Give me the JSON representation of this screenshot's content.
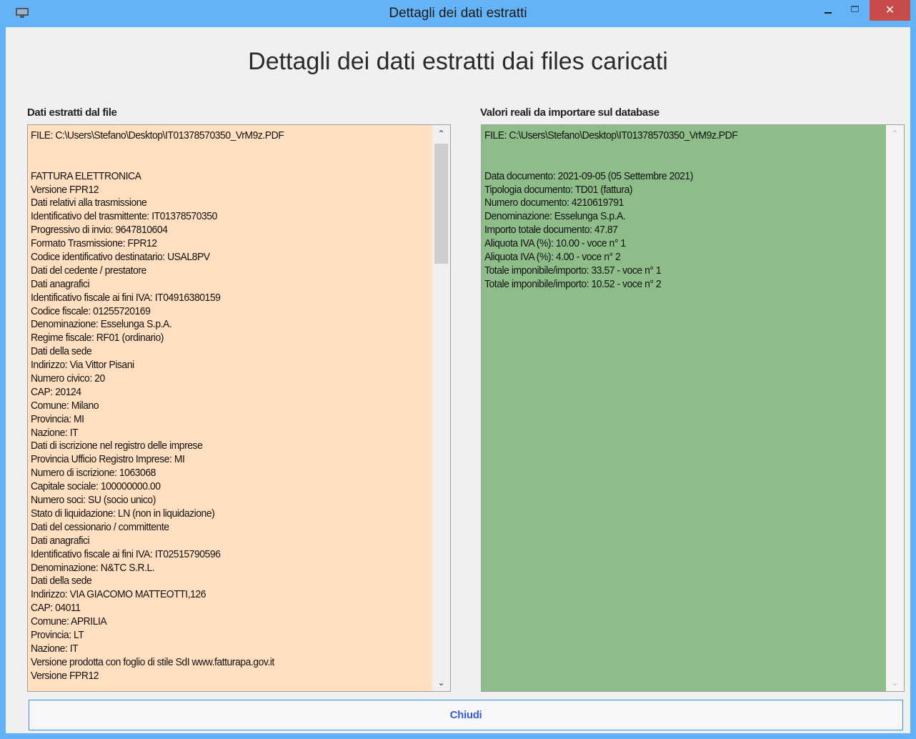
{
  "window": {
    "title": "Dettagli dei dati estratti"
  },
  "main": {
    "title": "Dettagli dei dati estratti dai files caricati",
    "left_label": "Dati estratti dal file",
    "right_label": "Valori reali da importare sul database",
    "left_lines": [
      "FILE: C:\\Users\\Stefano\\Desktop\\IT01378570350_VrM9z.PDF",
      "",
      "",
      "FATTURA ELETTRONICA",
      "Versione FPR12",
      "Dati relativi alla trasmissione",
      "Identificativo del trasmittente: IT01378570350",
      "Progressivo di invio: 9647810604",
      "Formato Trasmissione: FPR12",
      "Codice identificativo destinatario: USAL8PV",
      "Dati del cedente / prestatore",
      "Dati anagrafici",
      "Identificativo fiscale ai fini IVA: IT04916380159",
      "Codice fiscale: 01255720169",
      "Denominazione: Esselunga S.p.A.",
      "Regime fiscale: RF01 (ordinario)",
      "Dati della sede",
      "Indirizzo: Via Vittor Pisani",
      "Numero civico: 20",
      "CAP: 20124",
      "Comune: Milano",
      "Provincia: MI",
      "Nazione: IT",
      "Dati di iscrizione nel registro delle imprese",
      "Provincia Ufficio Registro Imprese: MI",
      "Numero di iscrizione: 1063068",
      "Capitale sociale: 100000000.00",
      "Numero soci: SU (socio unico)",
      "Stato di liquidazione: LN (non in liquidazione)",
      "Dati del cessionario / committente",
      "Dati anagrafici",
      "Identificativo fiscale ai fini IVA: IT02515790596",
      "Denominazione: N&TC S.R.L.",
      "Dati della sede",
      "Indirizzo: VIA GIACOMO MATTEOTTI,126",
      "CAP: 04011",
      "Comune: APRILIA",
      "Provincia: LT",
      "Nazione: IT",
      "Versione prodotta con foglio di stile SdI www.fatturapa.gov.it",
      "Versione FPR12"
    ],
    "right_lines": [
      "FILE: C:\\Users\\Stefano\\Desktop\\IT01378570350_VrM9z.PDF",
      "",
      "",
      "Data documento: 2021-09-05 (05 Settembre 2021)",
      "Tipologia documento: TD01 (fattura)",
      "Numero documento: 4210619791",
      "Denominazione: Esselunga S.p.A.",
      "Importo totale documento: 47.87",
      "Aliquota IVA (%): 10.00 - voce n° 1",
      "Aliquota IVA (%): 4.00 - voce n° 2",
      "Totale imponibile/importo: 33.57 - voce n° 1",
      "Totale imponibile/importo: 10.52 - voce n° 2"
    ],
    "close_label": "Chiudi"
  },
  "icons": {
    "app": "monitor-icon",
    "minimize": "minimize-icon",
    "maximize": "maximize-icon",
    "close": "close-icon",
    "scroll_up": "chevron-up-icon",
    "scroll_down": "chevron-down-icon"
  },
  "colors": {
    "titlebar": "#64b3f7",
    "close_button": "#c74b48",
    "left_textbox": "#ffdfbf",
    "right_textbox": "#8fbd8a",
    "button_text": "#3a5bd6"
  }
}
